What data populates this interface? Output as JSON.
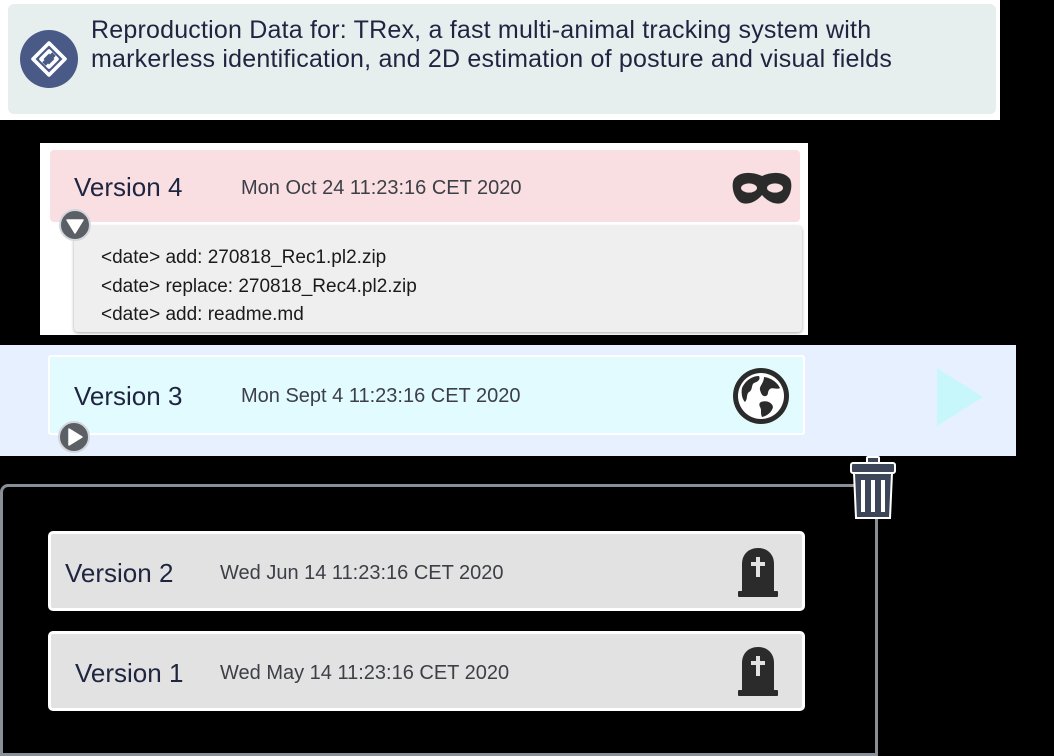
{
  "header": {
    "logo_icon": "diamond-link-logo-icon",
    "title": "Reproduction Data for: TRex, a fast multi-animal tracking system with markerless identification, and 2D estimation of posture and visual fields"
  },
  "versions": [
    {
      "label": "Version 4",
      "date": "Mon Oct 24 11:23:16 CET 2020",
      "icon": "incognito-mask-icon",
      "expanded": true,
      "changes": [
        "<date> add: 270818_Rec1.pl2.zip",
        "<date> replace: 270818_Rec4.pl2.zip",
        "<date> add: readme.md"
      ]
    },
    {
      "label": "Version 3",
      "date": "Mon Sept 4 11:23:16 CET 2020",
      "icon": "globe-icon",
      "expanded": false
    },
    {
      "label": "Version 2",
      "date": "Wed Jun 14 11:23:16 CET 2020",
      "icon": "tombstone-icon"
    },
    {
      "label": "Version 1",
      "date": "Wed May 14 11:23:16 CET 2020",
      "icon": "tombstone-icon"
    }
  ],
  "colors": {
    "header_bg": "#e6eeee",
    "logo_bg": "#4a5a86",
    "version4_bg": "#f9dfe2",
    "version3_bg": "#e2fbff",
    "archived_bg": "#e2e2e2",
    "play_arrow": "#c8f7fb",
    "trash": "#3d4658"
  }
}
